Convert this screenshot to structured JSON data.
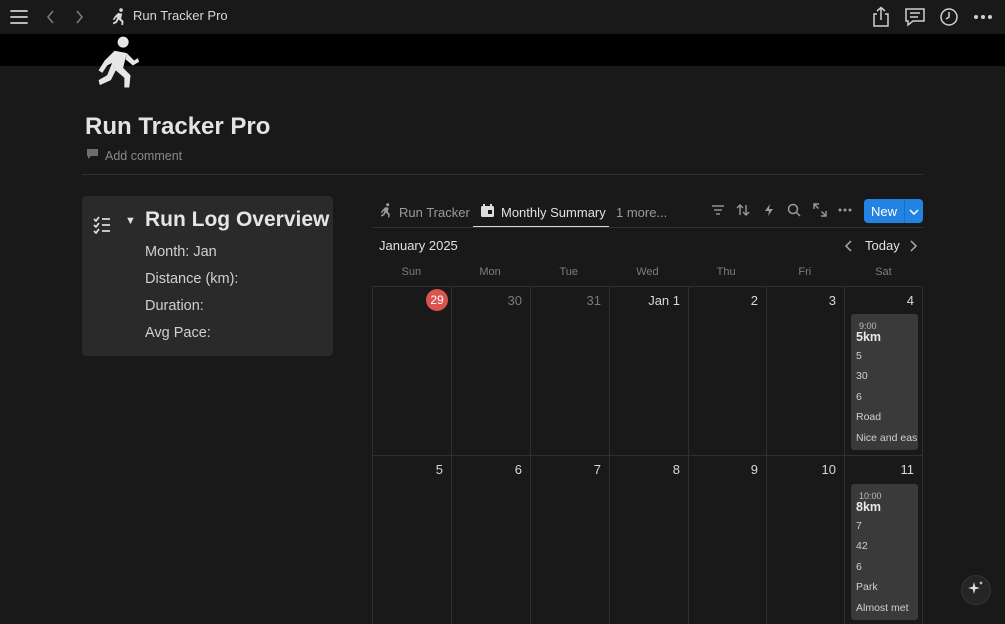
{
  "topbar": {
    "title": "Run Tracker Pro",
    "icons": [
      "menu-icon",
      "back-icon",
      "forward-icon",
      "runner-icon",
      "share-icon",
      "comments-icon",
      "history-icon",
      "more-icon"
    ]
  },
  "page": {
    "title": "Run Tracker Pro",
    "add_comment": "Add comment",
    "icon": "runner-icon"
  },
  "callout": {
    "heading": "Run Log Overview",
    "lines": [
      "Month: Jan",
      "Distance (km):",
      "Duration:",
      "Avg Pace:"
    ],
    "icon": "checklist-icon"
  },
  "tabs": [
    {
      "label": "Run Tracker",
      "icon": "runner-icon",
      "active": false
    },
    {
      "label": "Monthly Summary",
      "icon": "calendar-icon",
      "active": true
    },
    {
      "label": "1 more...",
      "active": false
    }
  ],
  "toolbar": {
    "new_label": "New",
    "icons": [
      "filter-icon",
      "sort-icon",
      "automation-icon",
      "search-icon",
      "expand-icon",
      "more-icon"
    ]
  },
  "calendar": {
    "month": "January 2025",
    "today_label": "Today",
    "weekdays": [
      "Sun",
      "Mon",
      "Tue",
      "Wed",
      "Thu",
      "Fri",
      "Sat"
    ],
    "week1": [
      "29",
      "30",
      "31",
      "Jan 1",
      "2",
      "3",
      "4"
    ],
    "week2": [
      "5",
      "6",
      "7",
      "8",
      "9",
      "10",
      "11"
    ],
    "today_date": "29"
  },
  "events": [
    {
      "time": "9:00",
      "title": "5km",
      "props": [
        "5",
        "30",
        "6",
        "Road",
        "Nice and eas"
      ]
    },
    {
      "time": "10:00",
      "title": "8km",
      "props": [
        "7",
        "42",
        "6",
        "Park",
        "Almost met"
      ]
    }
  ],
  "colors": {
    "background": "#191919",
    "accent": "#2383e2",
    "today_badge": "#d9534f"
  }
}
